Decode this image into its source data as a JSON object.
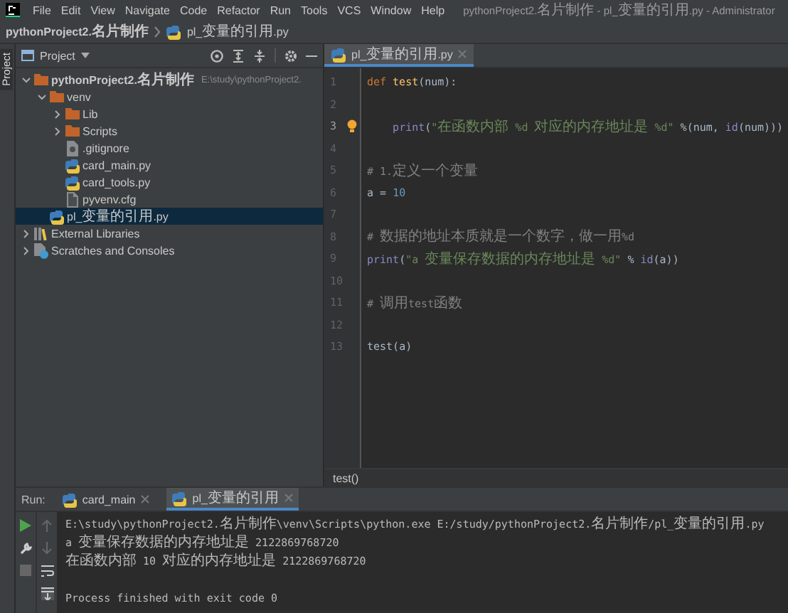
{
  "menu_bar": {
    "items": [
      "File",
      "Edit",
      "View",
      "Navigate",
      "Code",
      "Refactor",
      "Run",
      "Tools",
      "VCS",
      "Window",
      "Help"
    ],
    "title": "pythonProject2.名片制作 - pl_变量的引用.py - Administrator"
  },
  "breadcrumb": {
    "project": "pythonProject2.名片制作",
    "file": "pl_变量的引用.py"
  },
  "tool_stripe": {
    "label": "Project"
  },
  "project_panel": {
    "title": "Project",
    "tree": [
      {
        "label": "pythonProject2.名片制作",
        "path": "E:\\study\\pythonProject2.",
        "kind": "folder",
        "expanded": true,
        "selected": false,
        "children": [
          {
            "label": "venv",
            "kind": "folder",
            "expanded": true,
            "selected": false,
            "children": [
              {
                "label": "Lib",
                "kind": "folder",
                "expanded": false,
                "selected": false
              },
              {
                "label": "Scripts",
                "kind": "folder",
                "expanded": false,
                "selected": false
              },
              {
                "label": ".gitignore",
                "kind": "file",
                "selected": false
              },
              {
                "label": "card_main.py",
                "kind": "python",
                "selected": false
              },
              {
                "label": "card_tools.py",
                "kind": "python",
                "selected": false
              },
              {
                "label": "pyvenv.cfg",
                "kind": "file",
                "selected": false
              }
            ]
          },
          {
            "label": "pl_变量的引用.py",
            "kind": "python",
            "selected": true
          }
        ]
      },
      {
        "label": "External Libraries",
        "kind": "library",
        "expanded": false,
        "selected": false
      },
      {
        "label": "Scratches and Consoles",
        "kind": "scratches",
        "expanded": false,
        "selected": false
      }
    ]
  },
  "editor": {
    "tabs": [
      {
        "label": "pl_变量的引用.py",
        "selected": true
      }
    ],
    "lines": [
      {
        "number": "1",
        "current": false,
        "hint": false,
        "tokens": [
          {
            "kind": "keyword",
            "text": "def"
          },
          {
            "kind": "funcdef",
            "text": "test"
          },
          {
            "kind": "plain",
            "text": "(num):"
          }
        ]
      },
      {
        "number": "2",
        "current": false,
        "hint": false
      },
      {
        "number": "3",
        "current": true,
        "hint": true,
        "tokens": [
          {
            "kind": "builtin",
            "text": "    print"
          },
          {
            "kind": "plain",
            "text": "("
          },
          {
            "kind": "string",
            "text": "\"在函数内部 %d 对应的内存地址是 %d\""
          },
          {
            "kind": "plain",
            "text": " %(num, "
          },
          {
            "kind": "builtin",
            "text": "id"
          },
          {
            "kind": "plain",
            "text": "(num)))"
          }
        ]
      },
      {
        "number": "4",
        "current": false,
        "hint": false
      },
      {
        "number": "5",
        "current": false,
        "hint": false,
        "tokens": [
          {
            "kind": "comment",
            "text": "# 1.定义一个变量"
          }
        ]
      },
      {
        "number": "6",
        "current": false,
        "hint": false,
        "tokens": [
          {
            "kind": "plain",
            "text": "a = "
          },
          {
            "kind": "number",
            "text": "10"
          }
        ]
      },
      {
        "number": "7",
        "current": false,
        "hint": false
      },
      {
        "number": "8",
        "current": false,
        "hint": false,
        "tokens": [
          {
            "kind": "comment",
            "text": "# 数据的地址本质就是一个数字，做一用%d"
          }
        ]
      },
      {
        "number": "9",
        "current": false,
        "hint": false,
        "tokens": [
          {
            "kind": "builtin",
            "text": "print"
          },
          {
            "kind": "plain",
            "text": "("
          },
          {
            "kind": "string",
            "text": "\"a 变量保存数据的内存地址是 %d\""
          },
          {
            "kind": "plain",
            "text": " % "
          },
          {
            "kind": "builtin",
            "text": "id"
          },
          {
            "kind": "plain",
            "text": "(a))"
          }
        ]
      },
      {
        "number": "10",
        "current": false,
        "hint": false
      },
      {
        "number": "11",
        "current": false,
        "hint": false,
        "tokens": [
          {
            "kind": "comment",
            "text": "# 调用test函数"
          }
        ]
      },
      {
        "number": "12",
        "current": false,
        "hint": false
      },
      {
        "number": "13",
        "current": false,
        "hint": false,
        "tokens": [
          {
            "kind": "plain",
            "text": "test(a)"
          }
        ]
      }
    ],
    "breadcrumb": "test()"
  },
  "run_panel": {
    "label": "Run:",
    "tabs": [
      {
        "label": "card_main",
        "selected": false
      },
      {
        "label": "pl_变量的引用",
        "selected": true
      }
    ],
    "output": [
      {
        "kind": "command",
        "text": "E:\\study\\pythonProject2.名片制作\\venv\\Scripts\\python.exe E:/study/pythonProject2.名片制作/pl_变量的引用.py"
      },
      {
        "kind": "output",
        "text": "a 变量保存数据的内存地址是 2122869768720"
      },
      {
        "kind": "output",
        "text": "在函数内部 10 对应的内存地址是 2122869768720"
      },
      {
        "kind": "exit",
        "text": "Process finished with exit code 0"
      }
    ]
  }
}
